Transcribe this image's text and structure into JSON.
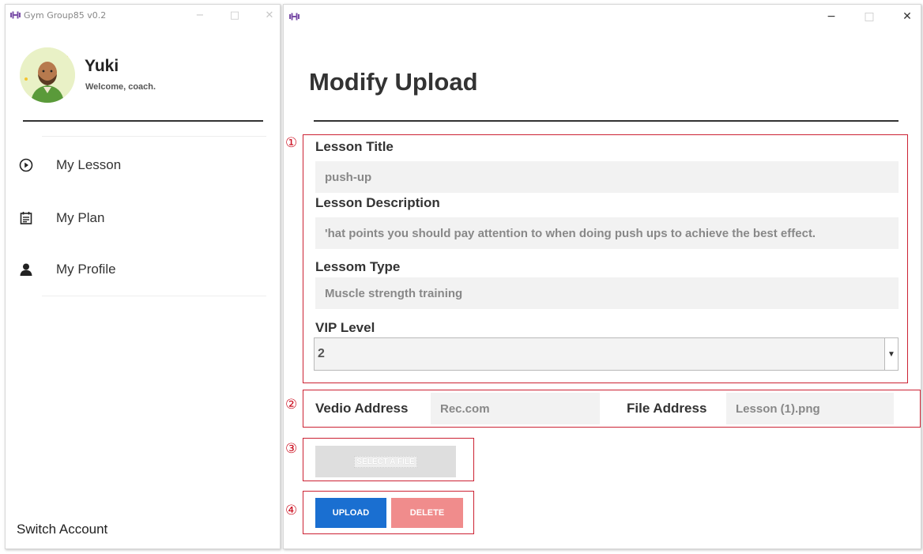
{
  "left_window": {
    "title": "Gym Group85 v0.2",
    "user": {
      "name": "Yuki",
      "welcome": "Welcome, coach."
    },
    "nav": [
      {
        "label": "My Lesson",
        "icon": "play-circle-icon"
      },
      {
        "label": "My Plan",
        "icon": "calendar-icon"
      },
      {
        "label": "My Profile",
        "icon": "person-icon"
      }
    ],
    "switch_account": "Switch Account"
  },
  "right_window": {
    "page_title": "Modify Upload",
    "markers": [
      "①",
      "②",
      "③",
      "④"
    ],
    "form": {
      "lesson_title_label": "Lesson Title",
      "lesson_title_value": "push-up",
      "lesson_description_label": "Lesson Description",
      "lesson_description_value": "'hat points you should pay attention to when doing push ups to achieve the best effect.",
      "lesson_type_label": "Lessom Type",
      "lesson_type_value": "Muscle strength training",
      "vip_level_label": "VIP Level",
      "vip_level_value": "2",
      "video_address_label": "Vedio Address",
      "video_address_value": "Rec.com",
      "file_address_label": "File Address",
      "file_address_value": "Lesson (1).png"
    },
    "buttons": {
      "select_file": "SELECT A FILE",
      "upload": "UPLOAD",
      "delete": "DELETE"
    }
  },
  "colors": {
    "accent_purple": "#7b4fa8",
    "upload_blue": "#1a6fd1",
    "delete_pink": "#f08c8c",
    "annotation_red": "#cc2233"
  }
}
